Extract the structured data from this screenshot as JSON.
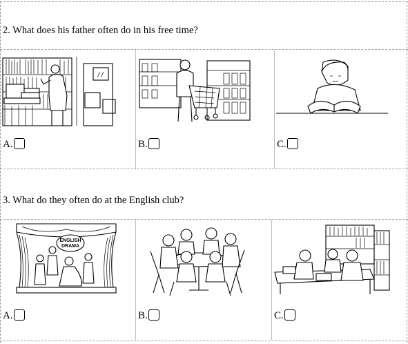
{
  "questions": [
    {
      "number": "2.",
      "text": "What does his father often do in his free time?",
      "options": [
        {
          "letter": "A.",
          "picture": "man-choosing-books-in-library"
        },
        {
          "letter": "B.",
          "picture": "man-pushing-shopping-cart-in-supermarket"
        },
        {
          "letter": "C.",
          "picture": "boy-reading-book-at-table"
        }
      ]
    },
    {
      "number": "3.",
      "text": "What do they often do at the English club?",
      "options": [
        {
          "letter": "A.",
          "picture": "children-performing-on-stage",
          "sign_text": "ENGLISH DRAMA"
        },
        {
          "letter": "B.",
          "picture": "children-talking-around-table"
        },
        {
          "letter": "C.",
          "picture": "children-reading-in-library"
        }
      ]
    }
  ]
}
